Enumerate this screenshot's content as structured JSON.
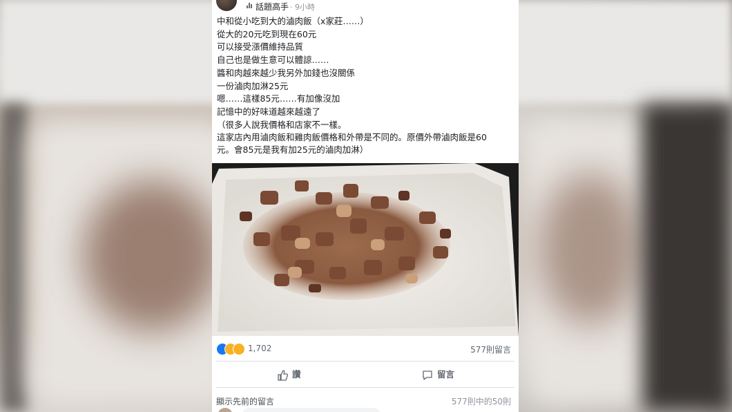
{
  "post": {
    "author": "話題高手",
    "time": "· 9小時",
    "lines": [
      "中和從小吃到大的滷肉飯（x家莊……）",
      "從大的20元吃到現在60元",
      "可以接受漲價維持品質",
      "自己也是做生意可以體諒……",
      "醬和肉越來越少我另外加錢也沒關係",
      "一份滷肉加淋25元",
      "嗯……這樣85元……有加像沒加",
      "記憶中的好味道越來越遠了"
    ],
    "note_lines": [
      "（很多人說我價格和店家不一樣。",
      "這家店內用滷肉飯和雞肉飯價格和外帶是不同的。原價外帶滷肉飯是60",
      "元。會85元是我有加25元的滷肉加淋）"
    ]
  },
  "stats": {
    "reaction_icons": [
      "like-icon",
      "wow-icon",
      "haha-icon"
    ],
    "reaction_count": "1,702",
    "comment_count": "577則留言"
  },
  "actions": {
    "like_label": "讚",
    "comment_label": "留言"
  },
  "comments": {
    "show_previous": "顯示先前的留言",
    "range": "577則中的50則"
  },
  "colors": {
    "facebook_blue": "#1877f2",
    "reaction_yellow": "#f7b125",
    "secondary_text": "#606770"
  }
}
